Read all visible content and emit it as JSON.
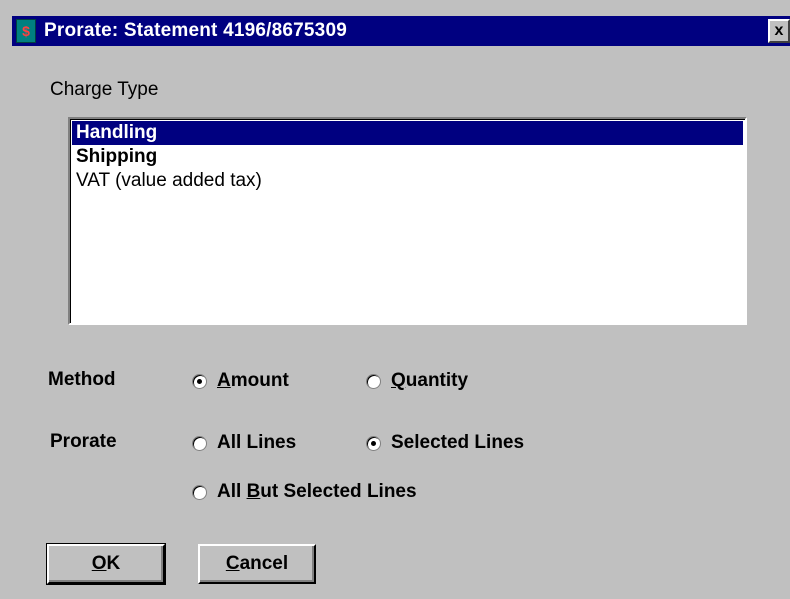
{
  "window": {
    "title": "Prorate: Statement 4196/8675309",
    "icon": "dollar-icon",
    "close_glyph": "x"
  },
  "charge_type": {
    "label": "Charge Type",
    "items": [
      {
        "label": "Handling",
        "selected": true
      },
      {
        "label": "Shipping",
        "selected": false
      },
      {
        "label": "VAT (value added tax)",
        "selected": false
      }
    ]
  },
  "method": {
    "label": "Method",
    "options": [
      {
        "label": "Amount",
        "mnemonic": "A",
        "rest": "mount",
        "checked": true
      },
      {
        "label": "Quantity",
        "mnemonic": "Q",
        "rest": "uantity",
        "checked": false
      }
    ]
  },
  "prorate": {
    "label": "Prorate",
    "options": [
      {
        "label": "All Lines",
        "checked": false
      },
      {
        "label": "Selected Lines",
        "checked": true
      },
      {
        "label": "All But Selected Lines",
        "pre": "All ",
        "mnemonic": "B",
        "rest": "ut Selected Lines",
        "checked": false
      }
    ]
  },
  "buttons": {
    "ok": {
      "label": "OK",
      "mnemonic": "O",
      "rest": "K"
    },
    "cancel": {
      "label": "Cancel",
      "mnemonic": "C",
      "rest": "ancel"
    }
  },
  "colors": {
    "titlebar": "#000080",
    "selection": "#000080",
    "face": "#c0c0c0"
  }
}
